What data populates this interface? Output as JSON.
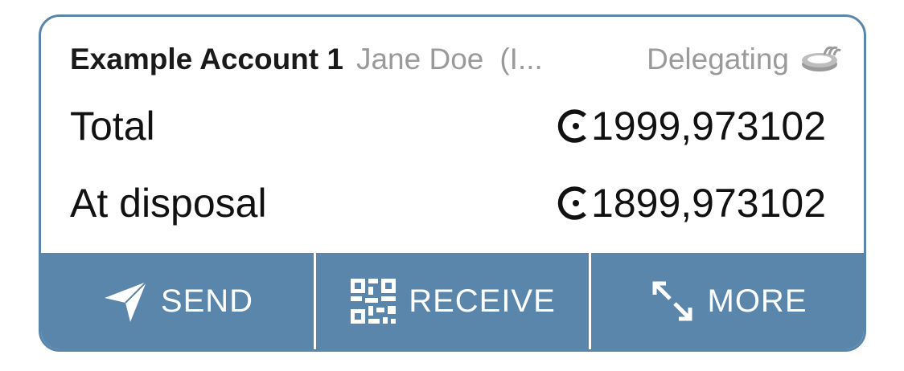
{
  "account": {
    "name": "Example Account 1",
    "owner": "Jane Doe",
    "identity_truncated": "(I...",
    "status": "Delegating"
  },
  "balances": {
    "total_label": "Total",
    "total_value": "1999,973102",
    "disposal_label": "At disposal",
    "disposal_value": "1899,973102"
  },
  "actions": {
    "send": "SEND",
    "receive": "RECEIVE",
    "more": "MORE"
  },
  "colors": {
    "accent": "#5a86ab",
    "muted_text": "#9a9a9a",
    "text": "#111111"
  },
  "icons": {
    "status": "delegation-icon",
    "currency": "ccd-icon",
    "send": "paper-plane-icon",
    "receive": "qr-code-icon",
    "more": "expand-arrows-icon"
  }
}
